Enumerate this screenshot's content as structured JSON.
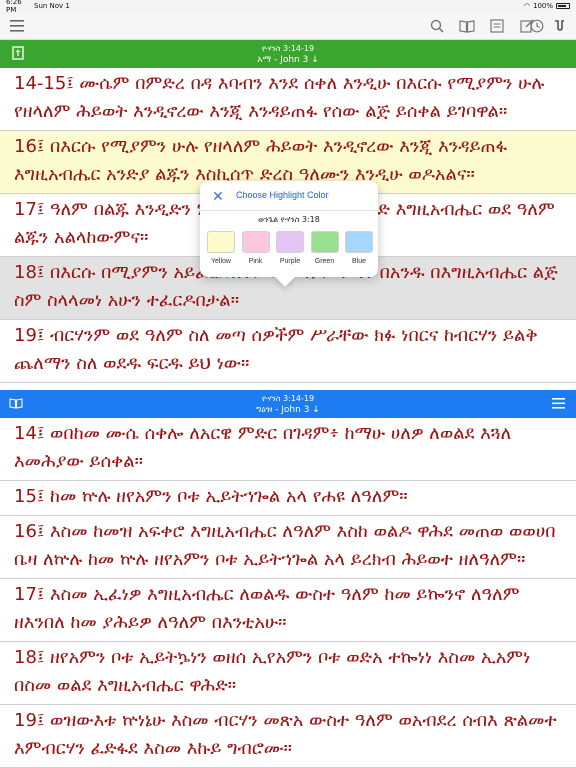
{
  "status": {
    "time": "6:26 PM",
    "date": "Sun Nov 1",
    "battery": "100%"
  },
  "top_header": {
    "ref": "ዮሃንስ 3:14-19",
    "version": "አማ - John 3 ↓"
  },
  "bottom_header": {
    "ref": "ዮሃንስ 3:14-19",
    "version": "ግዕዝ - John 3 ↓"
  },
  "top_verses": [
    "14-15፤ ሙሴም በምድረ በዳ እባብን እንደ ሰቀለ እንዲሁ በእርሱ የሚያምን ሁሉ የዘላለም ሕይወት እንዲኖረው እንጂ እንዳይጠፋ የሰው ልጅ ይሰቀል ይገባዋል።",
    "16፤ በእርሱ የሚያምን ሁሉ የዘላለም ሕይወት እንዲኖረው እንጂ እንዳይጠፋ እግዚአብሔር አንድያ ልጁን እስኪሰጥ ድረስ ዓለሙን እንዲሁ ወዶአልና።",
    "17፤ ዓለም በልጁ እንዲድን ነው እንጂ በዓለም እንዲፈርድ እግዚአብሔር ወደ ዓለም ልጁን አልላከውምና።",
    "18፤ በእርሱ በሚያምን አይፈረድበትም፤ በማያምን ግን በአንዱ በእግዚአብሔር ልጅ ስም ስላላመነ አሁን ተፈርዶበታል።",
    "19፤ ብርሃንም ወደ ዓለም ስለ መጣ ሰዎችም ሥራቸው ክፉ ነበርና ከብርሃን ይልቅ ጨለማን ስለ ወደዱ ፍርዱ ይህ ነው።"
  ],
  "bottom_verses": [
    "14፤ ወበከመ ሙሴ ሰቀሎ ለአርዌ ምድር በገዳም፥ ከማሁ ሀለዎ ለወልደ እጓለ እመሕያው ይሰቀል።",
    "15፤ ከመ ኵሉ ዘየአምን ቦቱ ኢይትኀጐል አላ የሐዩ ለዓለም።",
    "16፤ እስመ ከመዝ አፍቀሮ እግዚአብሔር ለዓለም እስከ ወልዶ ዋሕደ መጠወ ወወሀበ ቤዛ ለኵሉ ከመ ኵሉ ዘየአምን ቦቱ ኢይትኀጐል አላ ይረክብ ሕይወተ ዘለዓለም።",
    "17፤ እስመ ኢፈነዎ እግዚአብሔር ለወልዱ ውስተ ዓለም ከመ ይኰንኖ ለዓለም ዘእንበለ ከመ ያሕይዎ ለዓለም በእንቲአሁ።",
    "18፤ ዘየአምን ቦቱ ኢይትኴነን ወዘሰ ኢየአምን ቦቱ ወድአ ተኰነነ እስመ ኢአምነ በስመ ወልደ እግዚአብሔር ዋሕድ።",
    "19፤ ወዝውእቱ ኵነኔሁ እስመ ብርሃን መጽአ ውስተ ዓለም ወአብደረ ሰብእ ጽልመተ እምብርሃን ፈድፋደ እስመ እኩይ ግብሮሙ።"
  ],
  "popover": {
    "title": "Choose Highlight Color",
    "subtitle": "ወንጌል ዮሃንስ 3:18",
    "colors": [
      {
        "label": "Yellow",
        "hex": "#fdfbc9"
      },
      {
        "label": "Pink",
        "hex": "#fbc8df"
      },
      {
        "label": "Purple",
        "hex": "#e5c5f3"
      },
      {
        "label": "Green",
        "hex": "#98e08f"
      },
      {
        "label": "Blue",
        "hex": "#a6d6fb"
      }
    ]
  },
  "icons": {
    "toolbar_left": "menu-icon",
    "toolbar_right": [
      "search-icon",
      "book-icon",
      "bookmarks-icon",
      "edit-icon",
      "history-icon",
      "settings-icon"
    ],
    "top_header_left": "bible-icon",
    "bottom_header_left": "open-book-icon",
    "bottom_header_right": "menu-icon"
  },
  "colors": {
    "top_header": "#3aa52f",
    "bottom_header": "#1e7cf2",
    "verse_text": "#9b1212"
  }
}
